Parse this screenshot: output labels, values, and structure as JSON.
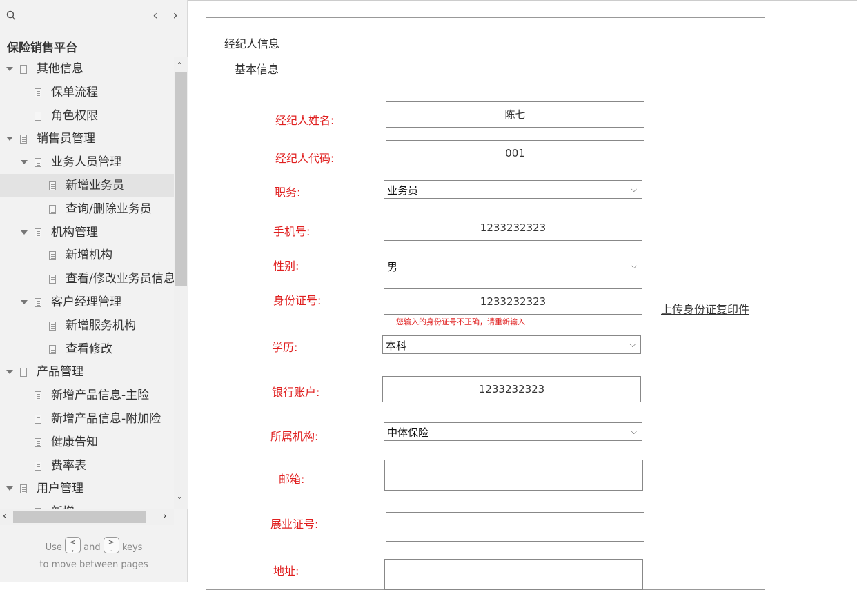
{
  "sidebar": {
    "project_title": "保险销售平台",
    "nav_prev_icon": "chevron-left-icon",
    "nav_next_icon": "chevron-right-icon",
    "tree": [
      {
        "label": "其他信息",
        "level": 0,
        "expanded": true
      },
      {
        "label": "保单流程",
        "level": 1
      },
      {
        "label": "角色权限",
        "level": 1
      },
      {
        "label": "销售员管理",
        "level": 0,
        "expanded": true
      },
      {
        "label": "业务人员管理",
        "level": 1,
        "expanded": true
      },
      {
        "label": "新增业务员",
        "level": 2,
        "selected": true
      },
      {
        "label": "查询/删除业务员",
        "level": 2
      },
      {
        "label": "机构管理",
        "level": 1,
        "expanded": true
      },
      {
        "label": "新增机构",
        "level": 2
      },
      {
        "label": "查看/修改业务员信息",
        "level": 2
      },
      {
        "label": "客户经理管理",
        "level": 1,
        "expanded": true
      },
      {
        "label": "新增服务机构",
        "level": 2
      },
      {
        "label": "查看修改",
        "level": 2
      },
      {
        "label": "产品管理",
        "level": 0,
        "expanded": true
      },
      {
        "label": "新增产品信息-主险",
        "level": 1
      },
      {
        "label": "新增产品信息-附加险",
        "level": 1
      },
      {
        "label": "健康告知",
        "level": 1
      },
      {
        "label": "费率表",
        "level": 1
      },
      {
        "label": "用户管理",
        "level": 0,
        "expanded": true
      },
      {
        "label": "新增",
        "level": 1
      }
    ],
    "key_hint": {
      "use": "Use",
      "key_prev": "<\n,",
      "and": "and",
      "key_next": ">\n.",
      "keys": "keys",
      "line2": "to move between pages"
    }
  },
  "form": {
    "section_title": "经纪人信息",
    "subsection_title": "基本信息",
    "fields": {
      "name": {
        "label": "经纪人姓名:",
        "value": "陈七"
      },
      "code": {
        "label": "经纪人代码:",
        "value": "001"
      },
      "position": {
        "label": "职务:",
        "value": "业务员"
      },
      "phone": {
        "label": "手机号:",
        "value": "1233232323"
      },
      "gender": {
        "label": "性别:",
        "value": "男"
      },
      "id_number": {
        "label": "身份证号:",
        "value": "1233232323",
        "error": "您输入的身份证号不正确，请重新输入"
      },
      "education": {
        "label": "学历:",
        "value": "本科"
      },
      "bank_account": {
        "label": "银行账户:",
        "value": "1233232323"
      },
      "organization": {
        "label": "所属机构:",
        "value": "中体保险"
      },
      "email": {
        "label": "邮箱:",
        "value": ""
      },
      "license": {
        "label": "展业证号:",
        "value": ""
      },
      "address": {
        "label": "地址:",
        "value": ""
      }
    },
    "upload_id_link": "上传身份证复印件"
  },
  "colors": {
    "required_label": "#e02020",
    "sidebar_bg": "#f2f2f2",
    "selected_bg": "#e3e3e3"
  }
}
